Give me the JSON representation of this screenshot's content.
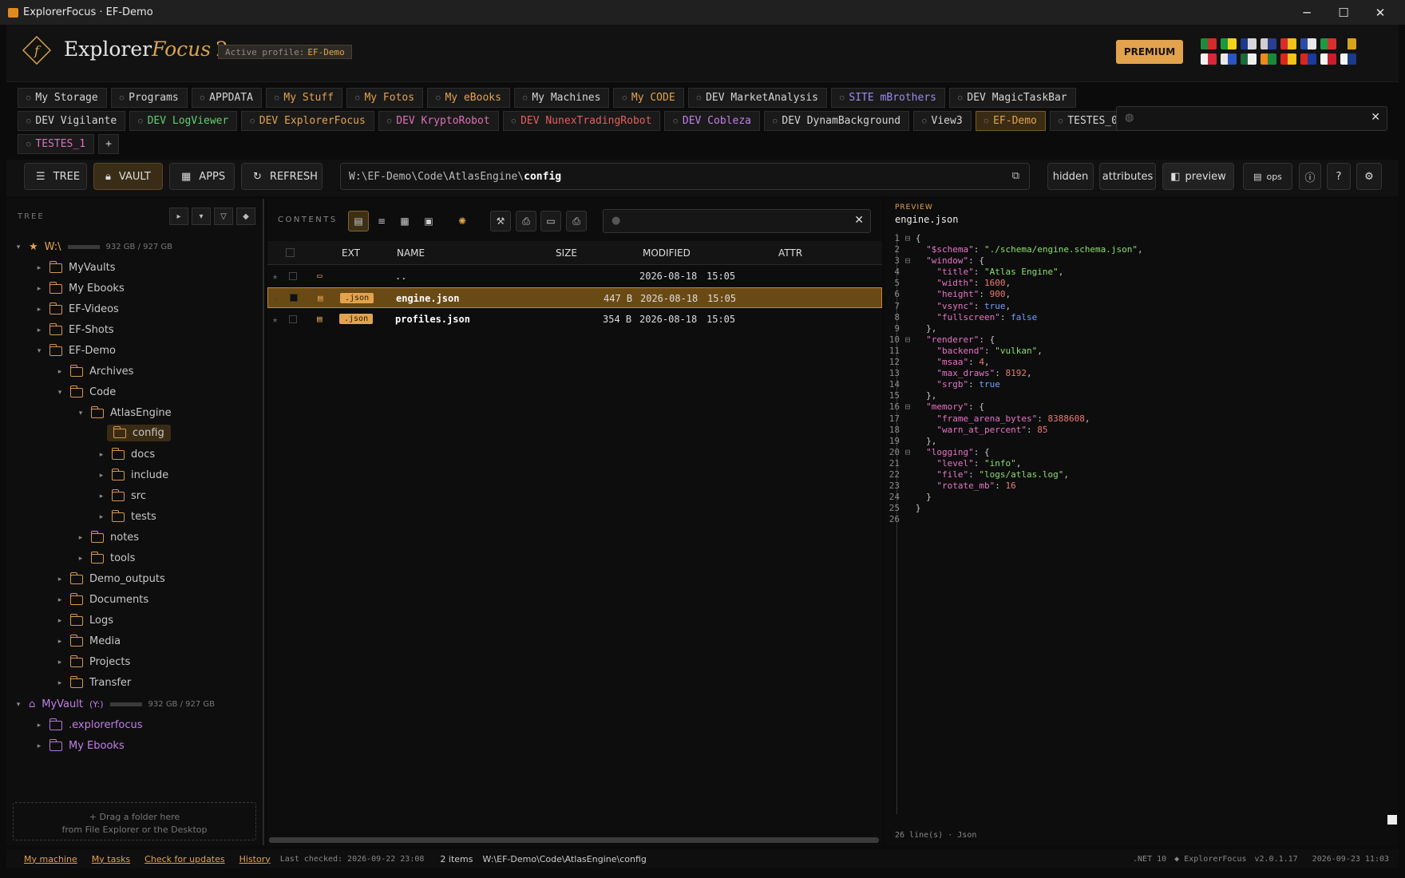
{
  "window": {
    "title": "ExplorerFocus · EF-Demo"
  },
  "brand": {
    "name_a": "Explorer",
    "name_b": "Focus",
    "version_mark": "2",
    "profile_label": "Active profile:",
    "profile_name": "EF-Demo",
    "premium": "PREMIUM"
  },
  "flags": [
    {
      "c1": "#1f8a3b",
      "c2": "#d62a2a"
    },
    {
      "c1": "#1a9a3c",
      "c2": "#f2d21a"
    },
    {
      "c1": "#1c3a8a",
      "c2": "#d8d8d8"
    },
    {
      "c1": "#cfcfcf",
      "c2": "#2a3f8f"
    },
    {
      "c1": "#d92b2b",
      "c2": "#f0c21a"
    },
    {
      "c1": "#2a4aa8",
      "c2": "#e8e8e8"
    },
    {
      "c1": "#1e9a45",
      "c2": "#d83030"
    },
    {
      "c1": "#111111",
      "c2": "#d8a21a"
    },
    {
      "c1": "#f0f0f0",
      "c2": "#d8283a"
    },
    {
      "c1": "#e8e8e8",
      "c2": "#2a56c4"
    },
    {
      "c1": "#1a6a3a",
      "c2": "#f0f0f0"
    },
    {
      "c1": "#f08a1a",
      "c2": "#1a8a3a"
    },
    {
      "c1": "#d8281e",
      "c2": "#f0c21a"
    },
    {
      "c1": "#d8281e",
      "c2": "#1a3aa0"
    },
    {
      "c1": "#f4f4f4",
      "c2": "#c81e2a"
    },
    {
      "c1": "#f4f4f4",
      "c2": "#1c3a8a"
    }
  ],
  "tabs_row1": [
    {
      "label": "My Storage",
      "color": "#d5d5d5"
    },
    {
      "label": "Programs",
      "color": "#d5d5d5"
    },
    {
      "label": "APPDATA",
      "color": "#d5d5d5"
    },
    {
      "label": "My Stuff",
      "color": "#e3a34d"
    },
    {
      "label": "My Fotos",
      "color": "#e3a34d"
    },
    {
      "label": "My eBooks",
      "color": "#e3a34d"
    },
    {
      "label": "My Machines",
      "color": "#d5d5d5"
    },
    {
      "label": "My CODE",
      "color": "#e3a34d"
    },
    {
      "label": "DEV MarketAnalysis",
      "color": "#d5d5d5"
    },
    {
      "label": "SITE mBrothers",
      "color": "#9b8cf0"
    },
    {
      "label": "DEV MagicTaskBar",
      "color": "#d5d5d5"
    }
  ],
  "tabs_row2": [
    {
      "label": "DEV Vigilante",
      "color": "#d5d5d5"
    },
    {
      "label": "DEV LogViewer",
      "color": "#5fcf6f"
    },
    {
      "label": "DEV ExplorerFocus",
      "color": "#e3a34d"
    },
    {
      "label": "DEV KryptoRobot",
      "color": "#e06fb8"
    },
    {
      "label": "DEV NunexTradingRobot",
      "color": "#e85d5d"
    },
    {
      "label": "DEV Cobleza",
      "color": "#c47ee8"
    },
    {
      "label": "DEV DynamBackground",
      "color": "#d5d5d5"
    },
    {
      "label": "View3",
      "color": "#d5d5d5"
    },
    {
      "label": "EF-Demo",
      "color": "#e3a34d"
    },
    {
      "label": "TESTES_0",
      "color": "#d5d5d5"
    }
  ],
  "tabs_row3": [
    {
      "label": "TESTES_1",
      "color": "#e06fb8"
    }
  ],
  "add_tab": "+",
  "toolbar": {
    "tree": "TREE",
    "vault": "VAULT",
    "apps": "APPS",
    "refresh": "REFRESH",
    "path_prefix": "W:\\EF-Demo\\Code\\AtlasEngine\\",
    "path_last": "config",
    "hidden": "hidden",
    "attributes": "attributes",
    "preview": "preview",
    "ops": "ops"
  },
  "tree": {
    "header": "TREE",
    "drive_w": {
      "label": "W:\\",
      "space": "932 GB / 927 GB"
    },
    "drive_y": {
      "label": "MyVault",
      "letter": "(Y:)",
      "space": "932 GB / 927 GB"
    },
    "items": {
      "myvaults": "MyVaults",
      "myebooks": "My Ebooks",
      "efvideos": "EF-Videos",
      "efshots": "EF-Shots",
      "efdemo": "EF-Demo",
      "archives": "Archives",
      "code": "Code",
      "atlas": "AtlasEngine",
      "config": "config",
      "docs": "docs",
      "include": "include",
      "src": "src",
      "tests": "tests",
      "notes": "notes",
      "tools": "tools",
      "demo_outputs": "Demo_outputs",
      "documents": "Documents",
      "logs": "Logs",
      "media": "Media",
      "projects": "Projects",
      "transfer": "Transfer",
      "explorerfocus": ".explorerfocus",
      "vault_ebooks": "My Ebooks"
    },
    "drop_line1": "+ Drag a folder here",
    "drop_line2": "from File Explorer or the Desktop"
  },
  "contents": {
    "header": "CONTENTS",
    "columns": {
      "ext": "EXT",
      "name": "NAME",
      "size": "SIZE",
      "modified": "MODIFIED",
      "attr": "ATTR"
    },
    "rows": [
      {
        "ext": "",
        "name": "..",
        "size": "",
        "date": "2026-08-18",
        "time": "15:05"
      },
      {
        "ext": ".json",
        "name": "engine.json",
        "size": "447 B",
        "date": "2026-08-18",
        "time": "15:05"
      },
      {
        "ext": ".json",
        "name": "profiles.json",
        "size": "354 B",
        "date": "2026-08-18",
        "time": "15:05"
      }
    ]
  },
  "preview": {
    "header": "PREVIEW",
    "filename": "engine.json",
    "footer_lines": "26 line(s)",
    "footer_type": "Json"
  },
  "status": {
    "my_machine": "My machine",
    "my_tasks": "My tasks",
    "check_updates": "Check for updates",
    "history": "History",
    "last_checked": "Last checked: 2026-09-22 23:08",
    "items": "2 items",
    "path": "W:\\EF-Demo\\Code\\AtlasEngine\\config",
    "runtime": ".NET 10",
    "product": "◆ ExplorerFocus",
    "version": "v2.0.1.17",
    "datetime": "2026-09-23  11:03"
  }
}
